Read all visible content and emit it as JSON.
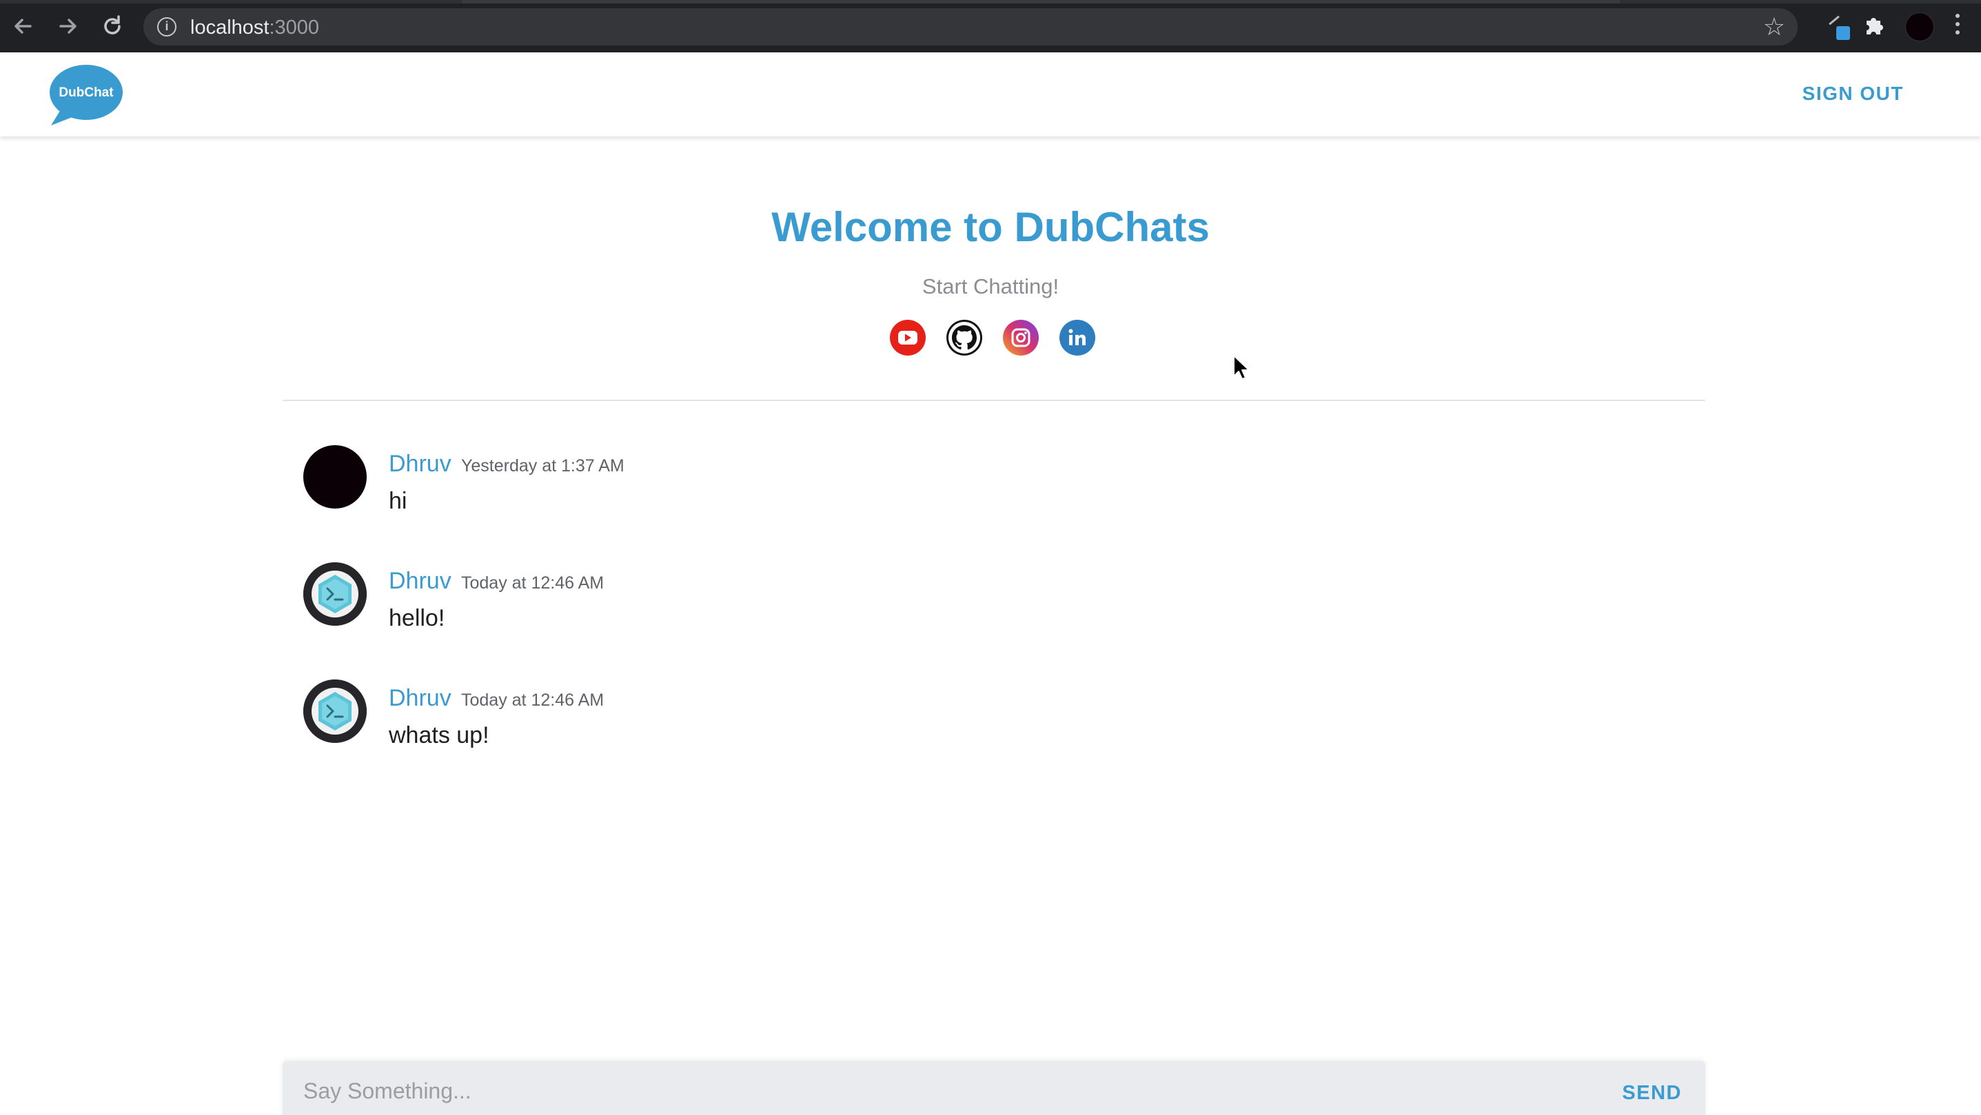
{
  "browser": {
    "url_host": "localhost",
    "url_port": ":3000",
    "icons": [
      "back-arrow-icon",
      "forward-arrow-icon",
      "reload-icon",
      "site-info-icon",
      "bookmark-star-icon",
      "extension-icon",
      "puzzle-icon",
      "profile-avatar",
      "kebab-menu-icon"
    ]
  },
  "header": {
    "logo_text": "DubChat",
    "signout_label": "SIGN OUT"
  },
  "hero": {
    "title": "Welcome to DubChats",
    "subtitle": "Start Chatting!",
    "socials": [
      "youtube-icon",
      "github-icon",
      "instagram-icon",
      "linkedin-icon"
    ]
  },
  "messages": [
    {
      "author": "Dhruv",
      "time": "Yesterday at 1:37 AM",
      "text": "hi",
      "avatar": "dark"
    },
    {
      "author": "Dhruv",
      "time": "Today at 12:46 AM",
      "text": "hello!",
      "avatar": "terminal"
    },
    {
      "author": "Dhruv",
      "time": "Today at 12:46 AM",
      "text": "whats up!",
      "avatar": "terminal"
    }
  ],
  "composer": {
    "placeholder": "Say Something...",
    "send_label": "SEND"
  },
  "colors": {
    "brand_blue": "#3a9bd1",
    "chrome_bg": "#202124",
    "youtube_red": "#e62117",
    "linkedin_blue": "#2d7dbf"
  }
}
